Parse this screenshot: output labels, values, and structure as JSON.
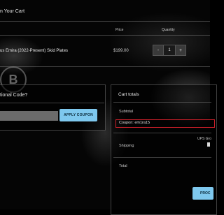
{
  "cart": {
    "title": "n Your Cart",
    "headers": {
      "price": "Price",
      "quantity": "Quantity"
    },
    "item": {
      "name": "us Emira (2022-Present) Skid Plates",
      "price": "$199.00",
      "quantity": "1",
      "decrement": "-",
      "increment": "+"
    }
  },
  "promo": {
    "title": "tional Code?",
    "input_value": "",
    "apply_label": "APPLY COUPON"
  },
  "totals": {
    "title": "Cart totals",
    "subtotal_label": "Subtotal",
    "coupon_label": "Coupon: em1ra15",
    "shipping_label": "Shipping",
    "shipping_method": "UPS Gro",
    "total_label": "Total",
    "proceed_label": "PROC"
  },
  "colors": {
    "accent_button": "#7ec8ee",
    "highlight_border": "#d0202a"
  }
}
